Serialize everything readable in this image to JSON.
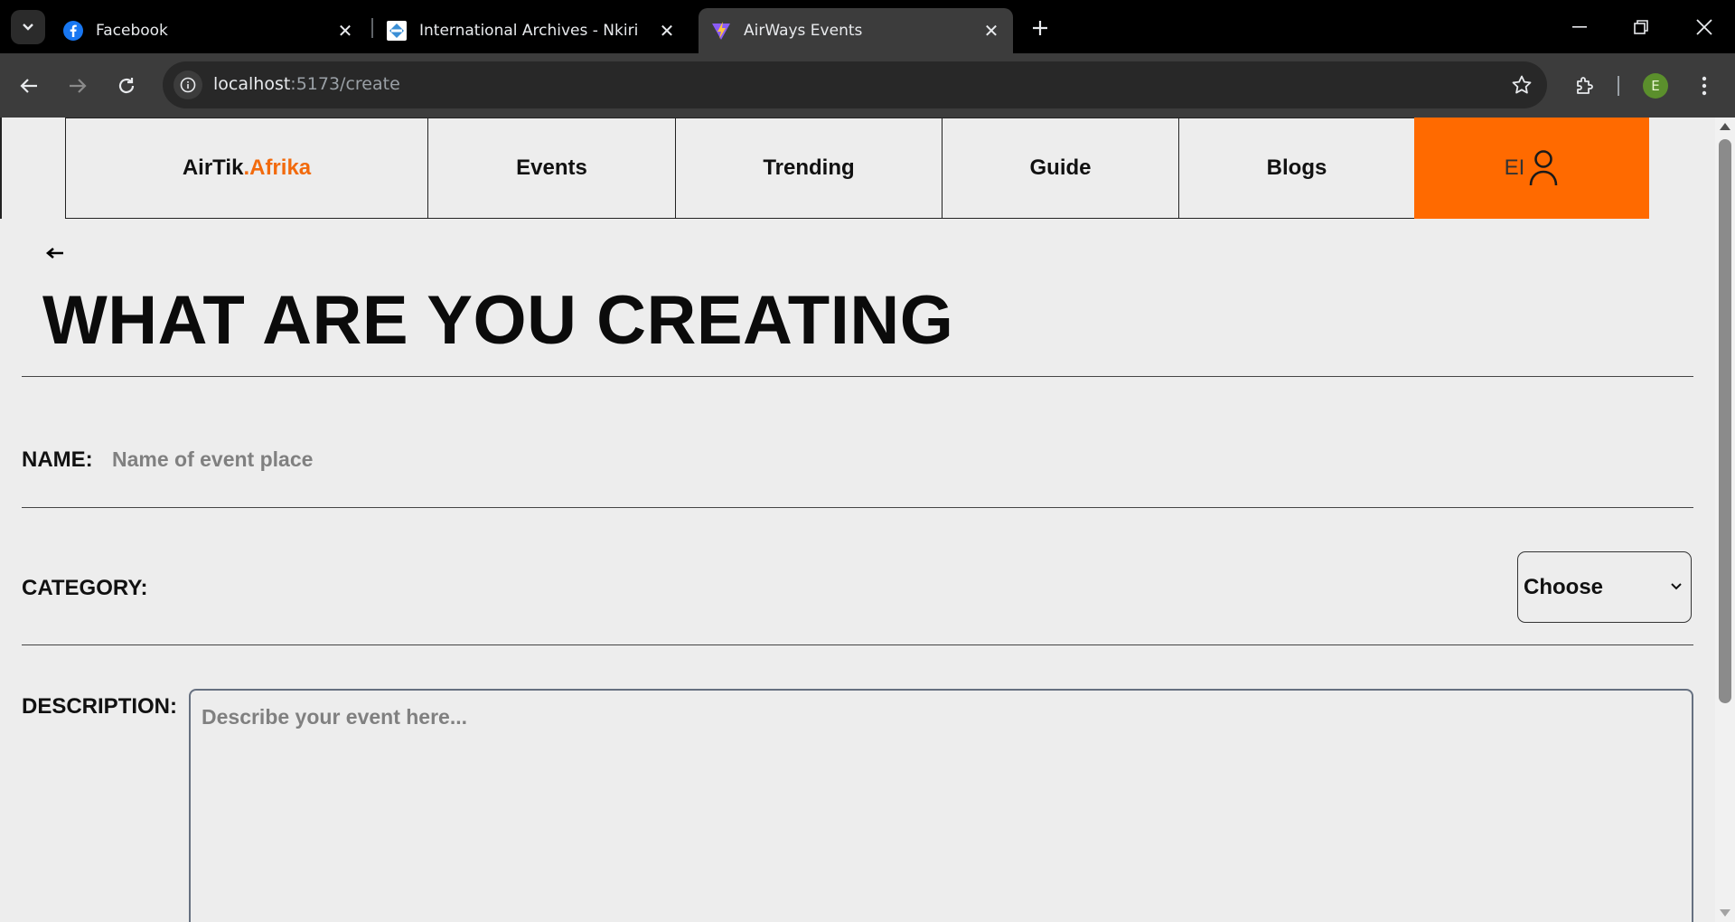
{
  "browser": {
    "tabs": [
      {
        "title": "Facebook",
        "icon": "facebook-icon",
        "active": false
      },
      {
        "title": "International Archives - Nkiri",
        "icon": "nkiri-icon",
        "active": false
      },
      {
        "title": "AirWays Events",
        "icon": "vite-icon",
        "active": true
      }
    ],
    "url_host": "localhost",
    "url_path": ":5173/create",
    "profile_initial": "E"
  },
  "nav": {
    "logo_main": "AirTik",
    "logo_accent": ".Afrika",
    "items": [
      "Events",
      "Trending",
      "Guide",
      "Blogs"
    ],
    "user_initials": "EI"
  },
  "page": {
    "title": "WHAT ARE YOU CREATING",
    "name_label": "NAME:",
    "name_placeholder": "Name of event place",
    "category_label": "CATEGORY:",
    "category_selected": "Choose",
    "description_label": "DESCRIPTION:",
    "description_placeholder": "Describe your event here..."
  },
  "colors": {
    "accent": "#ff6a00",
    "logo_accent": "#f26a0c",
    "page_bg": "#ededed"
  }
}
